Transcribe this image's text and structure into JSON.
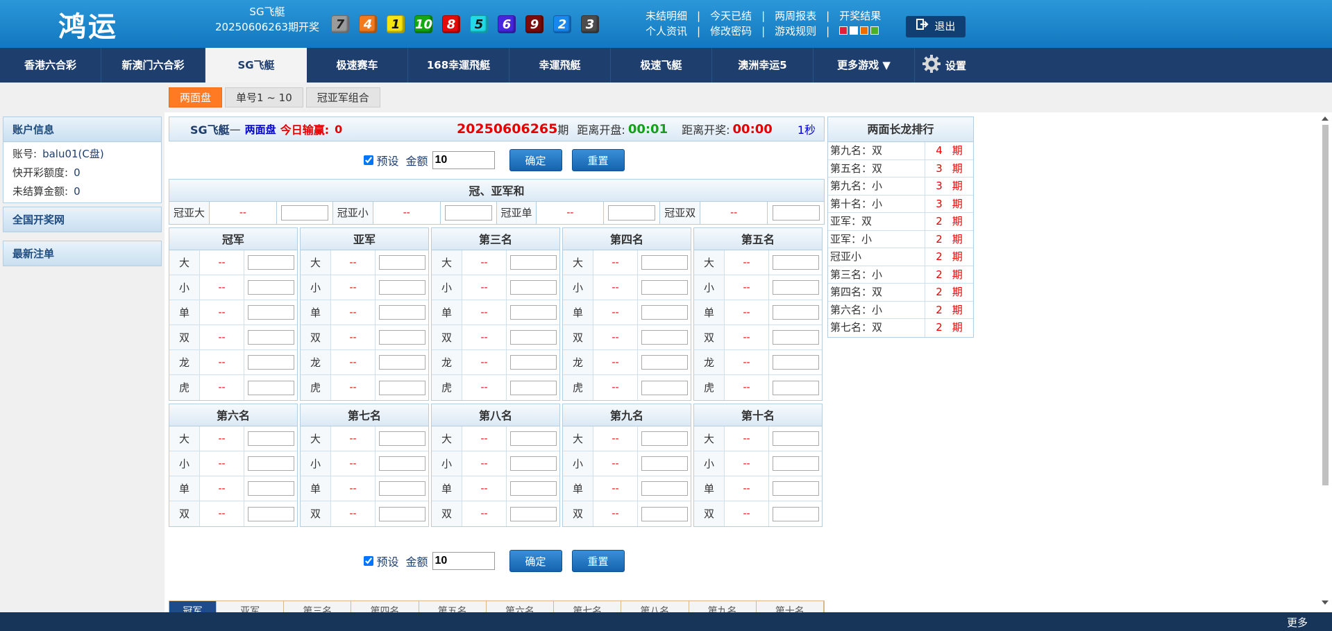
{
  "header": {
    "logo": "鸿运",
    "game_name": "SG飞艇",
    "draw_label": "20250606263期开奖",
    "balls": [
      {
        "num": "7",
        "color": "#9b9b9b"
      },
      {
        "num": "4",
        "color": "#f37b1d"
      },
      {
        "num": "1",
        "color": "#f5e410"
      },
      {
        "num": "10",
        "color": "#15a815"
      },
      {
        "num": "8",
        "color": "#e60b0b"
      },
      {
        "num": "5",
        "color": "#1fdbe8"
      },
      {
        "num": "6",
        "color": "#4726e0"
      },
      {
        "num": "9",
        "color": "#7d0b0b"
      },
      {
        "num": "2",
        "color": "#1888ef"
      },
      {
        "num": "3",
        "color": "#4c4c4c"
      }
    ],
    "links_row1": [
      "未结明细",
      "今天已结",
      "两周报表",
      "开奖结果"
    ],
    "links_row2": [
      "个人资讯",
      "修改密码",
      "游戏规则"
    ],
    "theme_colors": [
      "#e01f3a",
      "#ffffff",
      "#ef6c00",
      "#4caf2a"
    ],
    "logout": "退出"
  },
  "nav": {
    "items": [
      "香港六合彩",
      "新澳门六合彩",
      "SG飞艇",
      "极速赛车",
      "168幸運飛艇",
      "幸運飛艇",
      "极速飞艇",
      "澳洲幸运5",
      "更多游戏 ▼"
    ],
    "active": "SG飞艇",
    "settings": "设置"
  },
  "subtabs": [
    "两面盘",
    "单号1 ~ 10",
    "冠亚军组合"
  ],
  "sidebar": {
    "account_head": "账户信息",
    "account_rows": [
      {
        "label": "账号:",
        "value": "balu01(C盘)"
      },
      {
        "label": "快开彩额度:",
        "value": "0"
      },
      {
        "label": "未结算金额:",
        "value": "0"
      }
    ],
    "national": "全国开奖网",
    "latest": "最新注单"
  },
  "titlebar": {
    "game": "SG飞艇",
    "dash": " — ",
    "mode": "两面盘",
    "today_label": "今日输赢:",
    "today_value": "0",
    "issue": "20250606265",
    "issue_suffix": "期",
    "close_label": "距离开盘:",
    "close_value": "00:01",
    "draw_label": "距离开奖:",
    "draw_value": "00:00",
    "refresh": "1秒"
  },
  "preset": {
    "label": "预设",
    "amount_label": "金额",
    "amount_value": "10",
    "confirm": "确定",
    "reset": "重置"
  },
  "guanya": {
    "title": "冠、亚军和",
    "items": [
      {
        "label": "冠亚大",
        "odds": "--"
      },
      {
        "label": "冠亚小",
        "odds": "--"
      },
      {
        "label": "冠亚单",
        "odds": "--"
      },
      {
        "label": "冠亚双",
        "odds": "--"
      }
    ]
  },
  "grid_top": [
    {
      "title": "冠军",
      "rows": [
        {
          "l": "大",
          "o": "--"
        },
        {
          "l": "小",
          "o": "--"
        },
        {
          "l": "单",
          "o": "--"
        },
        {
          "l": "双",
          "o": "--"
        },
        {
          "l": "龙",
          "o": "--"
        },
        {
          "l": "虎",
          "o": "--"
        }
      ]
    },
    {
      "title": "亚军",
      "rows": [
        {
          "l": "大",
          "o": "--"
        },
        {
          "l": "小",
          "o": "--"
        },
        {
          "l": "单",
          "o": "--"
        },
        {
          "l": "双",
          "o": "--"
        },
        {
          "l": "龙",
          "o": "--"
        },
        {
          "l": "虎",
          "o": "--"
        }
      ]
    },
    {
      "title": "第三名",
      "rows": [
        {
          "l": "大",
          "o": "--"
        },
        {
          "l": "小",
          "o": "--"
        },
        {
          "l": "单",
          "o": "--"
        },
        {
          "l": "双",
          "o": "--"
        },
        {
          "l": "龙",
          "o": "--"
        },
        {
          "l": "虎",
          "o": "--"
        }
      ]
    },
    {
      "title": "第四名",
      "rows": [
        {
          "l": "大",
          "o": "--"
        },
        {
          "l": "小",
          "o": "--"
        },
        {
          "l": "单",
          "o": "--"
        },
        {
          "l": "双",
          "o": "--"
        },
        {
          "l": "龙",
          "o": "--"
        },
        {
          "l": "虎",
          "o": "--"
        }
      ]
    },
    {
      "title": "第五名",
      "rows": [
        {
          "l": "大",
          "o": "--"
        },
        {
          "l": "小",
          "o": "--"
        },
        {
          "l": "单",
          "o": "--"
        },
        {
          "l": "双",
          "o": "--"
        },
        {
          "l": "龙",
          "o": "--"
        },
        {
          "l": "虎",
          "o": "--"
        }
      ]
    }
  ],
  "grid_bottom": [
    {
      "title": "第六名",
      "rows": [
        {
          "l": "大",
          "o": "--"
        },
        {
          "l": "小",
          "o": "--"
        },
        {
          "l": "单",
          "o": "--"
        },
        {
          "l": "双",
          "o": "--"
        }
      ]
    },
    {
      "title": "第七名",
      "rows": [
        {
          "l": "大",
          "o": "--"
        },
        {
          "l": "小",
          "o": "--"
        },
        {
          "l": "单",
          "o": "--"
        },
        {
          "l": "双",
          "o": "--"
        }
      ]
    },
    {
      "title": "第八名",
      "rows": [
        {
          "l": "大",
          "o": "--"
        },
        {
          "l": "小",
          "o": "--"
        },
        {
          "l": "单",
          "o": "--"
        },
        {
          "l": "双",
          "o": "--"
        }
      ]
    },
    {
      "title": "第九名",
      "rows": [
        {
          "l": "大",
          "o": "--"
        },
        {
          "l": "小",
          "o": "--"
        },
        {
          "l": "单",
          "o": "--"
        },
        {
          "l": "双",
          "o": "--"
        }
      ]
    },
    {
      "title": "第十名",
      "rows": [
        {
          "l": "大",
          "o": "--"
        },
        {
          "l": "小",
          "o": "--"
        },
        {
          "l": "单",
          "o": "--"
        },
        {
          "l": "双",
          "o": "--"
        }
      ]
    }
  ],
  "rank_tabs": [
    "冠军",
    "亚军",
    "第三名",
    "第四名",
    "第五名",
    "第六名",
    "第七名",
    "第八名",
    "第九名",
    "第十名"
  ],
  "long_dragon": {
    "title": "两面长龙排行",
    "rows": [
      {
        "name": "第九名：双",
        "count": "4",
        "unit": "期"
      },
      {
        "name": "第五名：双",
        "count": "3",
        "unit": "期"
      },
      {
        "name": "第九名：小",
        "count": "3",
        "unit": "期"
      },
      {
        "name": "第十名：小",
        "count": "3",
        "unit": "期"
      },
      {
        "name": "亚军：双",
        "count": "2",
        "unit": "期"
      },
      {
        "name": "亚军：小",
        "count": "2",
        "unit": "期"
      },
      {
        "name": "冠亚小",
        "count": "2",
        "unit": "期"
      },
      {
        "name": "第三名：小",
        "count": "2",
        "unit": "期"
      },
      {
        "name": "第四名：双",
        "count": "2",
        "unit": "期"
      },
      {
        "name": "第六名：小",
        "count": "2",
        "unit": "期"
      },
      {
        "name": "第七名：双",
        "count": "2",
        "unit": "期"
      }
    ]
  },
  "footer": {
    "more": "更多"
  }
}
